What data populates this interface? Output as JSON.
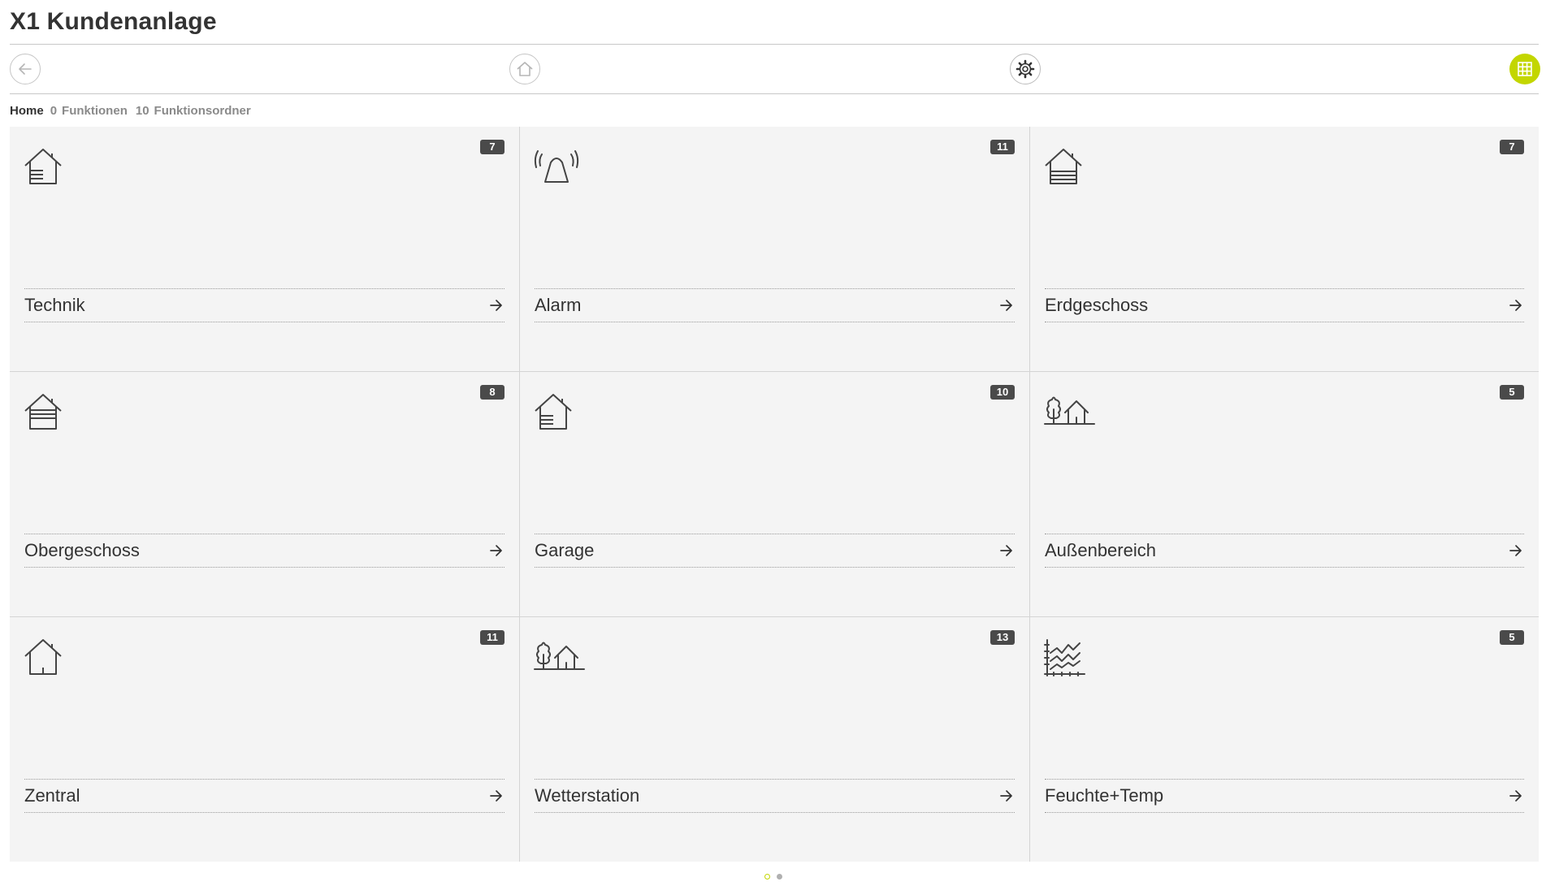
{
  "app": {
    "title": "X1 Kundenanlage"
  },
  "toolbar": {
    "back_icon": "arrow-left-icon",
    "home_icon": "home-icon",
    "settings_icon": "gear-icon",
    "grid_icon": "grid-view-icon",
    "accent_color": "#c3d600"
  },
  "breadcrumb": {
    "home": "Home",
    "functions_count": "0",
    "functions_label": "Funktionen",
    "folders_count": "10",
    "folders_label": "Funktionsordner"
  },
  "tiles": [
    {
      "label": "Technik",
      "count": "7",
      "icon": "house-lines-icon"
    },
    {
      "label": "Alarm",
      "count": "11",
      "icon": "alarm-bell-icon"
    },
    {
      "label": "Erdgeschoss",
      "count": "7",
      "icon": "house-ground-floor-icon"
    },
    {
      "label": "Obergeschoss",
      "count": "8",
      "icon": "house-upper-floor-icon"
    },
    {
      "label": "Garage",
      "count": "10",
      "icon": "house-lines-icon"
    },
    {
      "label": "Außenbereich",
      "count": "5",
      "icon": "tree-house-icon"
    },
    {
      "label": "Zentral",
      "count": "11",
      "icon": "house-icon"
    },
    {
      "label": "Wetterstation",
      "count": "13",
      "icon": "tree-house-icon"
    },
    {
      "label": "Feuchte+Temp",
      "count": "5",
      "icon": "chart-lines-icon"
    }
  ],
  "pager": {
    "pages": 2,
    "current": 1
  }
}
